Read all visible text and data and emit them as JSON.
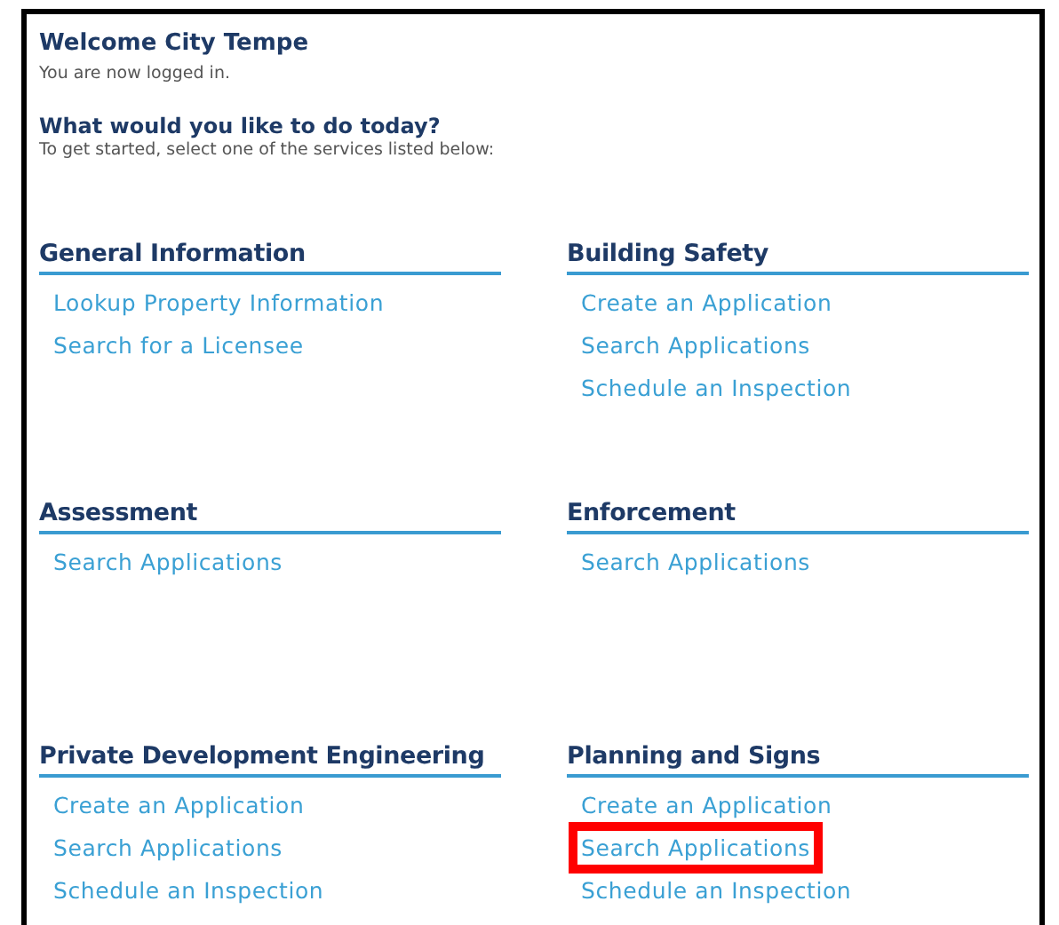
{
  "welcome": {
    "title": "Welcome City Tempe",
    "status": "You are now logged in."
  },
  "prompt": {
    "question": "What would you like to do today?",
    "instruction": "To get started, select one of the services listed below:"
  },
  "sections": [
    {
      "title": "General Information",
      "links": [
        {
          "label": "Lookup Property Information",
          "highlighted": false
        },
        {
          "label": "Search for a Licensee",
          "highlighted": false
        }
      ]
    },
    {
      "title": "Building Safety",
      "links": [
        {
          "label": "Create an Application",
          "highlighted": false
        },
        {
          "label": "Search Applications",
          "highlighted": false
        },
        {
          "label": "Schedule an Inspection",
          "highlighted": false
        }
      ]
    },
    {
      "title": "Assessment",
      "links": [
        {
          "label": "Search Applications",
          "highlighted": false
        }
      ]
    },
    {
      "title": "Enforcement",
      "links": [
        {
          "label": "Search Applications",
          "highlighted": false
        }
      ]
    },
    {
      "title": "Private Development Engineering",
      "links": [
        {
          "label": "Create an Application",
          "highlighted": false
        },
        {
          "label": "Search Applications",
          "highlighted": false
        },
        {
          "label": "Schedule an Inspection",
          "highlighted": false
        }
      ]
    },
    {
      "title": "Planning and Signs",
      "links": [
        {
          "label": "Create an Application",
          "highlighted": false
        },
        {
          "label": "Search Applications",
          "highlighted": true
        },
        {
          "label": "Schedule an Inspection",
          "highlighted": false
        }
      ]
    }
  ]
}
